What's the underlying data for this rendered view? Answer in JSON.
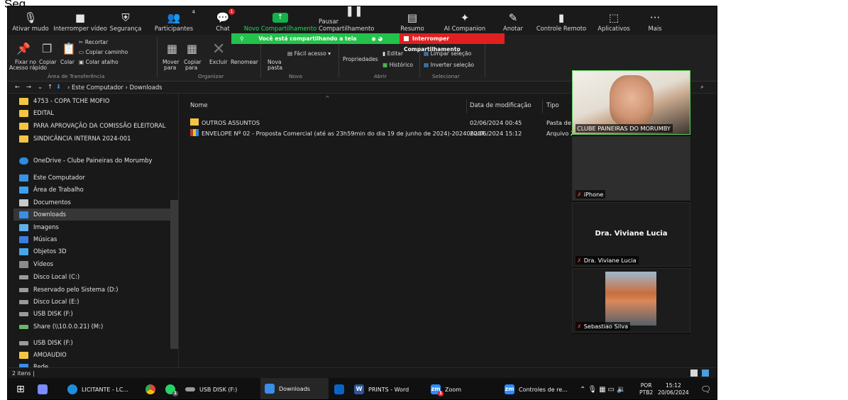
{
  "page_label": "Seg.",
  "zoom_toolbar": {
    "items": [
      {
        "label": "Ativar mudo",
        "icon": "microphone-icon"
      },
      {
        "label": "Interromper vídeo",
        "icon": "video-camera-icon"
      },
      {
        "label": "Segurança",
        "icon": "shield-icon"
      },
      {
        "label": "Participantes",
        "icon": "participants-icon"
      },
      {
        "label": "Chat",
        "icon": "chat-icon"
      },
      {
        "label": "Novo Compartilhamento",
        "icon": "share-screen-icon"
      },
      {
        "label": "Pausar Compartilhamento",
        "icon": "pause-icon"
      },
      {
        "label": "Resumo",
        "icon": "summary-icon"
      },
      {
        "label": "AI Companion",
        "icon": "sparkle-icon"
      },
      {
        "label": "Anotar",
        "icon": "pen-icon"
      },
      {
        "label": "Controle Remoto",
        "icon": "mouse-icon"
      },
      {
        "label": "Aplicativos",
        "icon": "apps-icon"
      },
      {
        "label": "Mais",
        "icon": "more-icon"
      }
    ],
    "participants_count": "4",
    "chat_badge": "1"
  },
  "share_banner": {
    "text": "Você está compartilhando a tela",
    "stop_label": "Interromper Compartilhamento"
  },
  "ribbon": {
    "recortar": "Recortar",
    "copiar_caminho": "Copiar caminho",
    "colar_atalho": "Colar atalho",
    "fixar": "Fixar no",
    "fixar2": "Acesso rápido",
    "copiar": "Copiar",
    "colar": "Colar",
    "mover": "Mover",
    "mover2": "para",
    "copiar_para": "Copiar",
    "copiar_para2": "para",
    "excluir": "Excluir",
    "renomear": "Renomear",
    "nova_pasta": "Nova",
    "nova_pasta2": "pasta",
    "facil_acesso": "Fácil acesso",
    "propriedades": "Propriedades",
    "editar": "Editar",
    "historico": "Histórico",
    "limpar": "Limpar seleção",
    "inverter": "Inverter seleção",
    "groups": {
      "transferencia": "Área de Transferência",
      "organizar": "Organizar",
      "novo": "Novo",
      "abrir": "Abrir",
      "selecionar": "Selecionar"
    }
  },
  "address": {
    "crumb1": "Este Computador",
    "crumb2": "Downloads"
  },
  "nav_items": [
    {
      "label": "4753 - COPA TCHE MOFIO",
      "icon": "folder-icon"
    },
    {
      "label": "EDITAL",
      "icon": "folder-icon"
    },
    {
      "label": "PARA APROVAÇÃO DA COMISSÃO ELEITORAL",
      "icon": "folder-icon"
    },
    {
      "label": "SINDICÂNCIA INTERNA 2024-001",
      "icon": "folder-icon"
    },
    {
      "label": "OneDrive - Clube Paineiras do Morumby",
      "icon": "cloud-icon"
    },
    {
      "label": "Este Computador",
      "icon": "computer-icon"
    },
    {
      "label": "Área de Trabalho",
      "icon": "desktop-icon"
    },
    {
      "label": "Documentos",
      "icon": "document-icon"
    },
    {
      "label": "Downloads",
      "icon": "download-icon"
    },
    {
      "label": "Imagens",
      "icon": "image-icon"
    },
    {
      "label": "Músicas",
      "icon": "music-icon"
    },
    {
      "label": "Objetos 3D",
      "icon": "cube-icon"
    },
    {
      "label": "Vídeos",
      "icon": "video-icon"
    },
    {
      "label": "Disco Local (C:)",
      "icon": "drive-icon"
    },
    {
      "label": "Reservado pelo Sistema (D:)",
      "icon": "drive-icon"
    },
    {
      "label": "Disco Local (E:)",
      "icon": "drive-icon"
    },
    {
      "label": "USB DISK (F:)",
      "icon": "usb-drive-icon"
    },
    {
      "label": "Share (\\\\10.0.0.21) (M:)",
      "icon": "network-drive-icon"
    },
    {
      "label": "USB DISK (F:)",
      "icon": "usb-drive-icon"
    },
    {
      "label": "AMOAUDIO",
      "icon": "folder-icon"
    },
    {
      "label": "Rede",
      "icon": "network-icon"
    }
  ],
  "columns": {
    "name": "Nome",
    "modified": "Data de modificação",
    "type": "Tipo"
  },
  "files": [
    {
      "name": "OUTROS ASSUNTOS",
      "date": "02/06/2024 00:45",
      "type": "Pasta de a",
      "icon": "folder-icon"
    },
    {
      "name": "ENVELOPE Nº 02 - Proposta Comercial (até as 23h59min do dia 19 de junho de 2024)-20240620T...",
      "date": "20/06/2024 15:12",
      "type": "Arquivo Z",
      "icon": "zip-archive-icon"
    }
  ],
  "gallery": [
    {
      "name": "CLUBE PAINEIRAS DO MORUMBY"
    },
    {
      "name": "iPhone"
    },
    {
      "name": "Dra. Viviane Lucia",
      "center_name": "Dra. Viviane Lucia"
    },
    {
      "name": "Sebastiao Silva"
    }
  ],
  "status": {
    "items": "2 itens"
  },
  "taskbar": {
    "apps": [
      {
        "label": "LICITANTE - LC...",
        "icon": "edge-icon"
      },
      {
        "label": "USB DISK (F:)",
        "icon": "usb-drive-icon"
      },
      {
        "label": "Downloads",
        "icon": "download-icon"
      },
      {
        "label": "PRINTS - Word",
        "icon": "word-icon"
      },
      {
        "label": "Zoom",
        "icon": "zoom-icon"
      },
      {
        "label": "Controles de re...",
        "icon": "zoom-icon"
      }
    ],
    "whatsapp_badge": "1",
    "zoom_badge": "1",
    "lang": "POR",
    "layout": "PTB2",
    "time": "15:12",
    "date": "20/06/2024"
  }
}
